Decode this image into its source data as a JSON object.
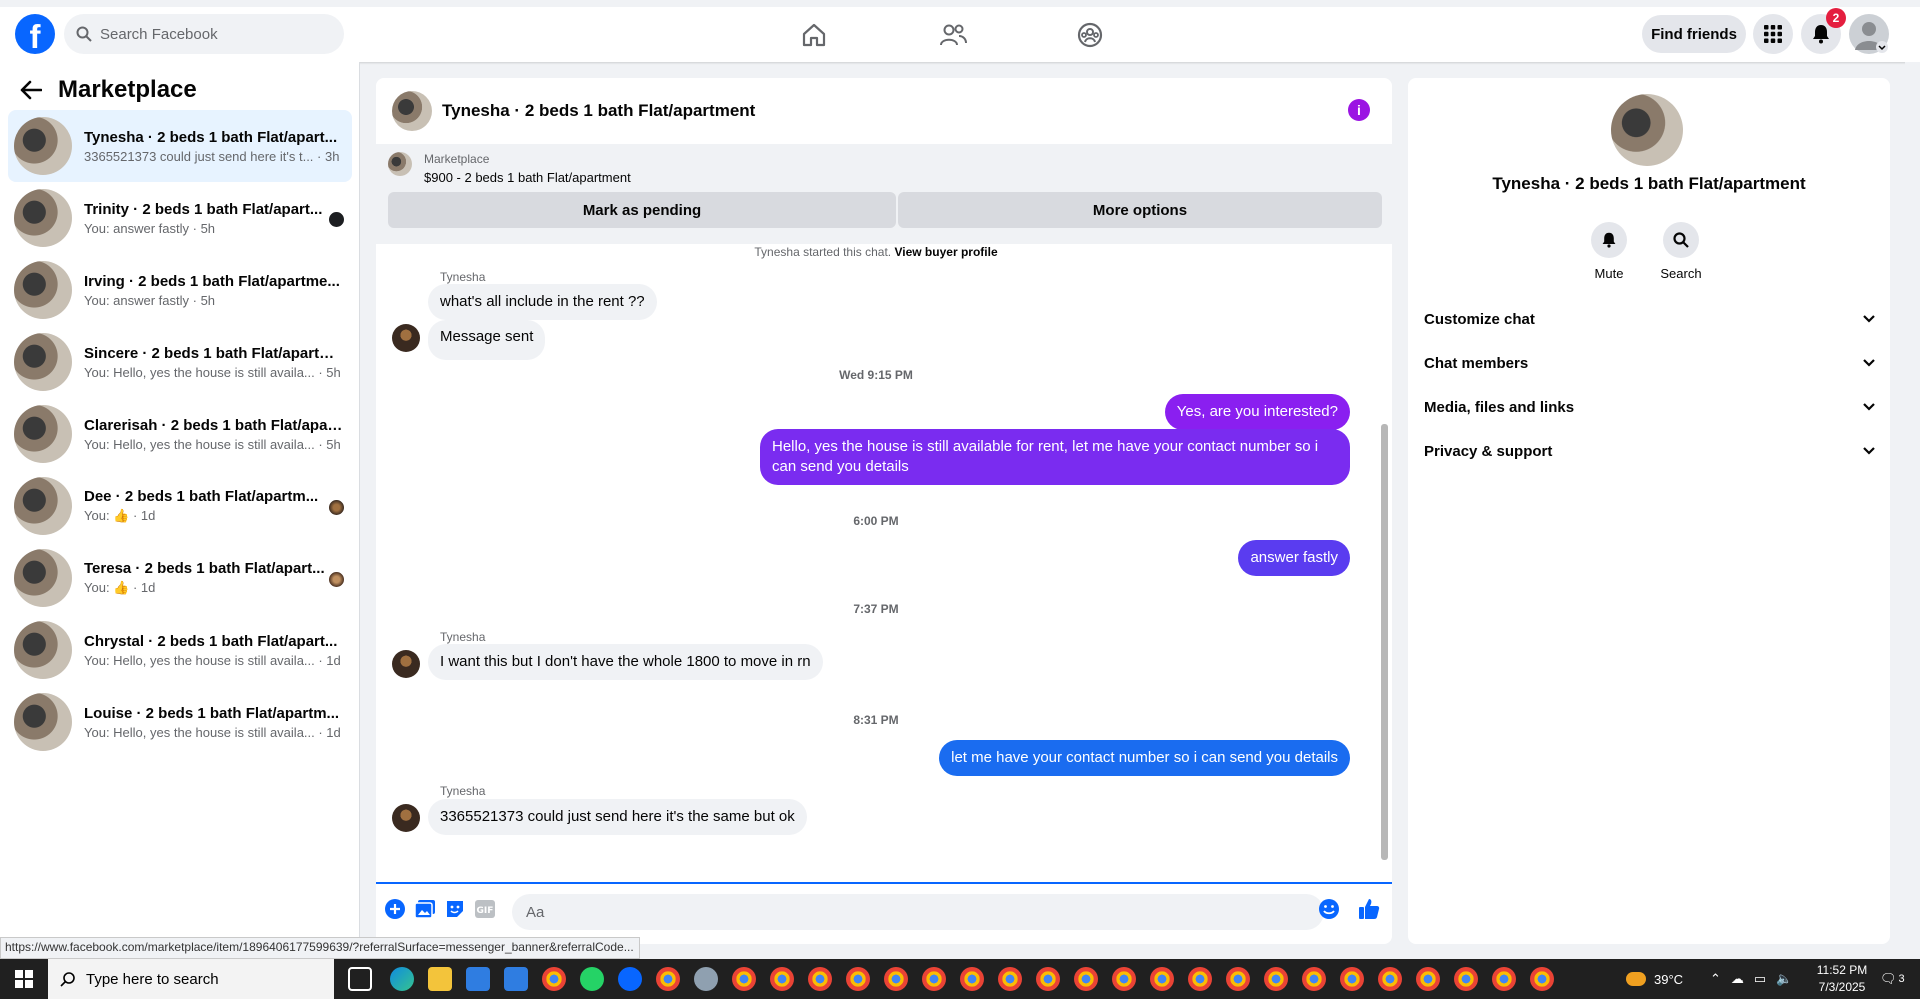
{
  "topbar": {
    "search_placeholder": "Search Facebook",
    "find_friends": "Find friends",
    "notif_count": "2",
    "logo": "f"
  },
  "sidebar": {
    "title": "Marketplace",
    "conversations": [
      {
        "title": "Tynesha · 2 beds 1 bath Flat/apart...",
        "sub": "3365521373 could just send here it's t... · 3h"
      },
      {
        "title": "Trinity · 2 beds 1 bath Flat/apart...",
        "sub": "You: answer fastly · 5h"
      },
      {
        "title": "Irving · 2 beds 1 bath Flat/apartme...",
        "sub": "You: answer fastly · 5h"
      },
      {
        "title": "Sincere · 2 beds 1 bath Flat/apartm...",
        "sub": "You: Hello, yes the house is still availa... · 5h"
      },
      {
        "title": "Clarerisah · 2 beds 1 bath Flat/apar...",
        "sub": "You: Hello, yes the house is still availa... · 5h"
      },
      {
        "title": "Dee · 2 beds 1 bath Flat/apartm...",
        "sub": "You: 👍 · 1d"
      },
      {
        "title": "Teresa · 2 beds 1 bath Flat/apart...",
        "sub": "You: 👍 · 1d"
      },
      {
        "title": "Chrystal · 2 beds 1 bath Flat/apart...",
        "sub": "You: Hello, yes the house is still availa... · 1d"
      },
      {
        "title": "Louise · 2 beds 1 bath Flat/apartm...",
        "sub": "You: Hello, yes the house is still availa... · 1d"
      }
    ]
  },
  "chat": {
    "title": "Tynesha · 2 beds 1 bath Flat/apartment",
    "info_icon": "i",
    "banner": {
      "label": "Marketplace",
      "price": "$900 - 2 beds 1 bath Flat/apartment",
      "pending": "Mark as pending",
      "more": "More options"
    },
    "start_text": "Tynesha started this chat.",
    "start_link": "View buyer profile",
    "sender": "Tynesha",
    "messages": {
      "m1": "what's all include in the rent ??",
      "m2": "Message sent",
      "t1": "Wed 9:15 PM",
      "m3": "Yes, are you interested?",
      "m4": "Hello, yes the house is still available for rent, let me have your contact number so i can send you details",
      "t2": "6:00 PM",
      "m5": "answer fastly",
      "t3": "7:37 PM",
      "m6": "I want this but I don't have the whole 1800 to move in rn",
      "t4": "8:31 PM",
      "m7": "let me have your contact number so i can send you details",
      "m8": "3365521373 could just send here it's the same but ok"
    },
    "composer_placeholder": "Aa",
    "colors": {
      "purple": "#8a1ff0",
      "indigo": "#5a3cf0",
      "blue": "#1a6cf0"
    }
  },
  "details": {
    "title": "Tynesha · 2 beds 1 bath Flat/apartment",
    "mute": "Mute",
    "search": "Search",
    "sections": [
      "Customize chat",
      "Chat members",
      "Media, files and links",
      "Privacy & support"
    ]
  },
  "status_url": "https://www.facebook.com/marketplace/item/1896406177599639/?referralSurface=messenger_banner&referralCode...",
  "taskbar": {
    "search_placeholder": "Type here to search",
    "temp": "39°C",
    "time": "11:52 PM",
    "date": "7/3/2025",
    "notif": "3"
  }
}
